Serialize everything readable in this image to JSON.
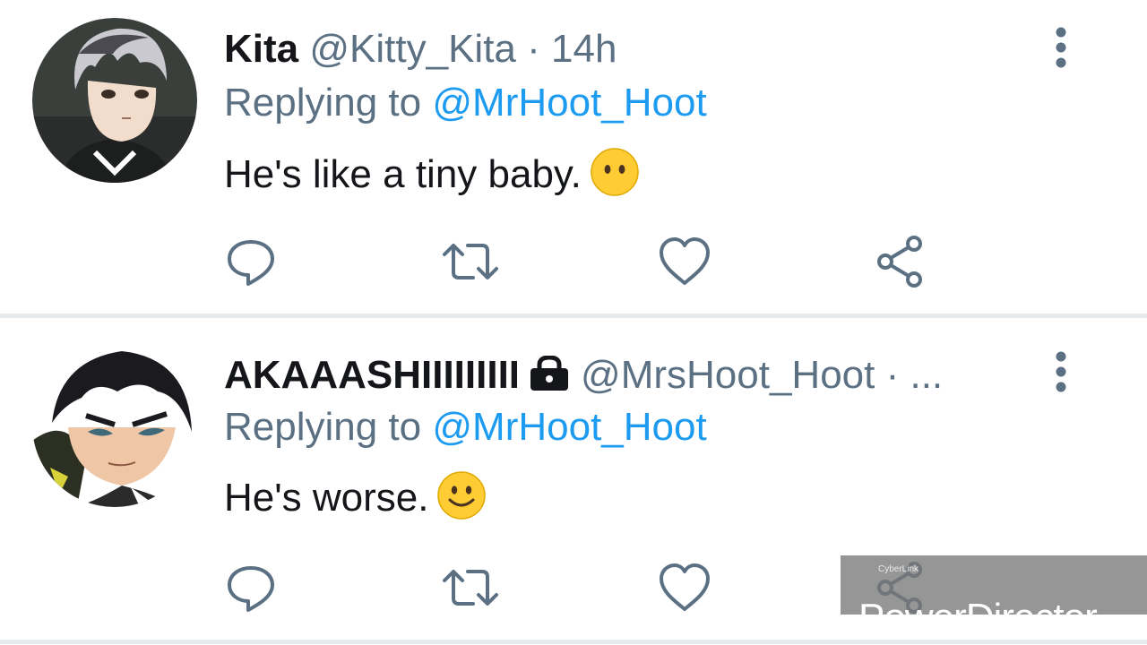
{
  "tweets": [
    {
      "name": "Kita",
      "handle": "@Kitty_Kita",
      "meta": "· 14h",
      "replying_prefix": "Replying to",
      "replying_to": "@MrHoot_Hoot",
      "text": "He's like a tiny baby.",
      "emoji": "neutral-face",
      "avatar_icon": "anime-avatar-silver-hair"
    },
    {
      "name": "AKAAASHIIIIIIIII",
      "locked_icon": "lock-icon",
      "handle": "@MrsHoot_Hoot",
      "meta": "· ...",
      "replying_prefix": "Replying to",
      "replying_to": "@MrHoot_Hoot",
      "text": "He's worse.",
      "emoji": "smiling-face",
      "avatar_icon": "anime-avatar-dark-hair"
    }
  ],
  "actions": [
    "reply-icon",
    "retweet-icon",
    "like-icon",
    "share-icon"
  ],
  "watermark": {
    "brand": "PowerDirector",
    "maker": "CyberLink"
  },
  "colors": {
    "accent": "#1d9bf0",
    "icon": "#5b7083",
    "text": "#141619",
    "divider": "#e7ebee"
  }
}
